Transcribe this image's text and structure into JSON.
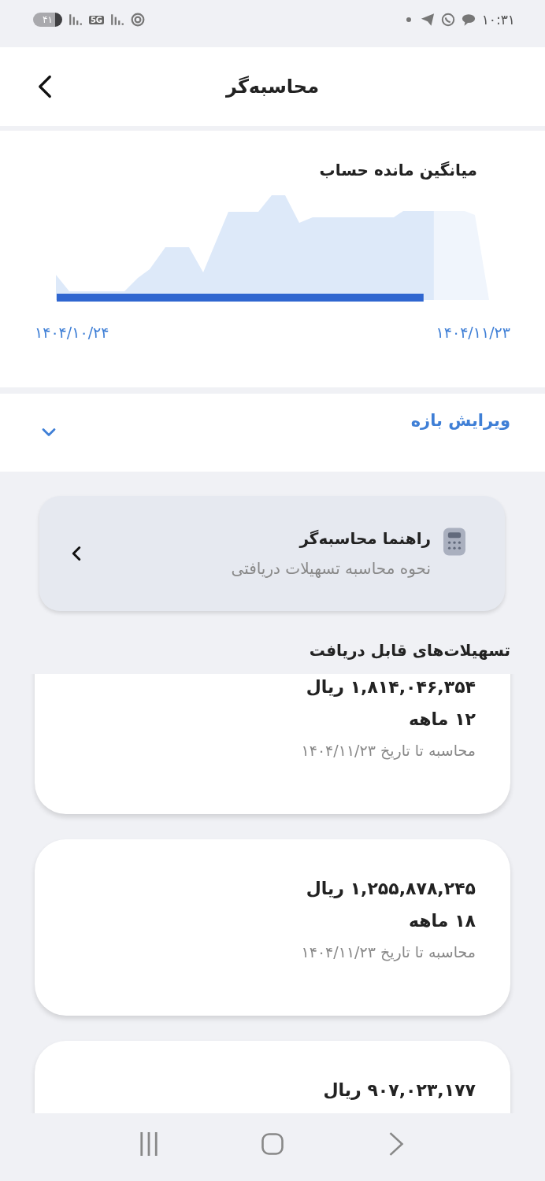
{
  "status_bar": {
    "time": "۱۰:۳۱",
    "battery": "۴۱",
    "network": "5G"
  },
  "header": {
    "title": "محاسبه‌گر"
  },
  "balance_chart": {
    "title": "میانگین مانده حساب",
    "range": {
      "level": 0.85
    },
    "start_date": "۱۴۰۴/۱۰/۲۴",
    "end_date": "۱۴۰۴/۱۱/۲۳"
  },
  "edit_range": {
    "label": "ویرایش بازه",
    "expanded": false
  },
  "guide_card": {
    "title": "راهنما محاسبه‌گر",
    "subtitle": "نحوه محاسبه تسهیلات دریافتی"
  },
  "loans": {
    "title": "تسهیلات‌های قابل دریافت",
    "items": [
      {
        "amount": "۱,۸۱۴,۰۴۶,۳۵۴ ریال",
        "term": "۱۲ ماهه",
        "note": "محاسبه تا تاریخ ۱۴۰۴/۱۱/۲۳"
      },
      {
        "amount": "۱,۲۵۵,۸۷۸,۲۴۵ ریال",
        "term": "۱۸ ماهه",
        "note": "محاسبه تا تاریخ ۱۴۰۴/۱۱/۲۳"
      },
      {
        "amount": "۹۰۷,۰۲۳,۱۷۷ ریال"
      }
    ]
  }
}
